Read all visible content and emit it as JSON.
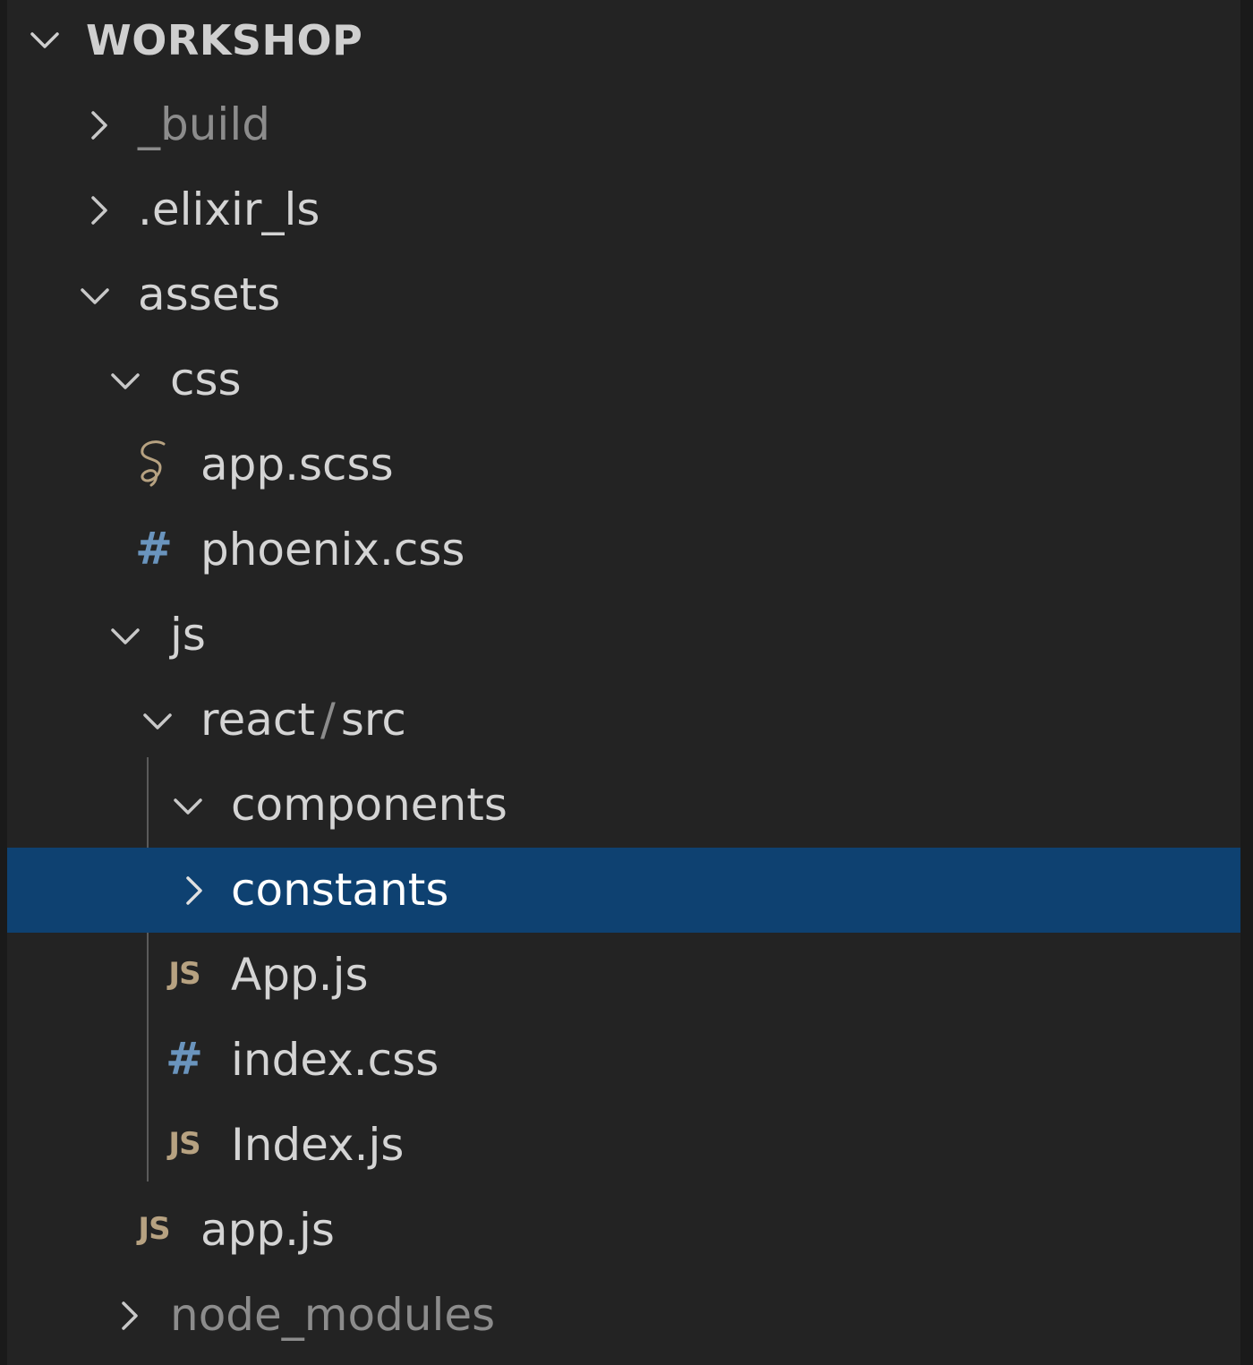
{
  "explorer": {
    "title": "WORKSHOP"
  },
  "tree": [
    {
      "label": "_build",
      "kind": "folder",
      "expanded": false,
      "dim": true
    },
    {
      "label": ".elixir_ls",
      "kind": "folder",
      "expanded": false,
      "dim": false
    },
    {
      "label": "assets",
      "kind": "folder",
      "expanded": true,
      "dim": false
    },
    {
      "label": "css",
      "kind": "folder",
      "expanded": true,
      "dim": false
    },
    {
      "label": "app.scss",
      "kind": "file",
      "icon": "sass-icon",
      "dim": false
    },
    {
      "label": "phoenix.css",
      "kind": "file",
      "icon": "css-hash-icon",
      "dim": false
    },
    {
      "label": "js",
      "kind": "folder",
      "expanded": true,
      "dim": false
    },
    {
      "label_parent": "react",
      "label_sep": "/",
      "label_child": "src",
      "kind": "folder",
      "expanded": true,
      "dim": false
    },
    {
      "label": "components",
      "kind": "folder",
      "expanded": true,
      "dim": false
    },
    {
      "label": "constants",
      "kind": "folder",
      "expanded": false,
      "selected": true,
      "dim": false
    },
    {
      "label": "App.js",
      "kind": "file",
      "icon": "js-icon",
      "icon_text": "JS",
      "dim": false
    },
    {
      "label": "index.css",
      "kind": "file",
      "icon": "css-hash-icon",
      "icon_text": "#",
      "dim": false
    },
    {
      "label": "Index.js",
      "kind": "file",
      "icon": "js-icon",
      "icon_text": "JS",
      "dim": false
    },
    {
      "label": "app.js",
      "kind": "file",
      "icon": "js-icon",
      "icon_text": "JS",
      "dim": false
    },
    {
      "label": "node_modules",
      "kind": "folder",
      "expanded": false,
      "dim": true
    }
  ],
  "colors": {
    "background": "#232323",
    "selection": "#0e4171",
    "text": "#d4d4d4",
    "dim_text": "#8c8c8c",
    "js_icon": "#b7a281",
    "css_icon": "#6a94bd"
  }
}
